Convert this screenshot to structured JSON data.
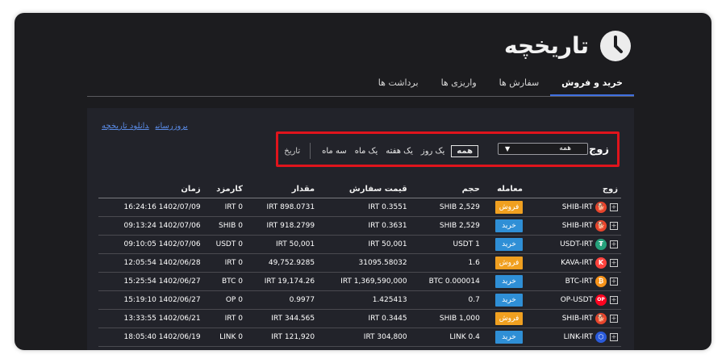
{
  "header": {
    "title": "تاریخچه",
    "tabs": [
      {
        "label": "خرید و فروش",
        "active": true
      },
      {
        "label": "سفارش ها",
        "active": false
      },
      {
        "label": "واریزی ها",
        "active": false
      },
      {
        "label": "برداشت ها",
        "active": false
      }
    ]
  },
  "links": {
    "update": "بروزرسانی",
    "download": "دانلود تاریخچه"
  },
  "filters": {
    "pair_label": "زوج :",
    "pair_select_value": "همه",
    "periods": [
      "همه",
      "یک روز",
      "یک هفته",
      "یک ماه",
      "سه ماه"
    ],
    "active_period": "همه",
    "date_label": "تاریخ"
  },
  "table": {
    "headers": [
      "زوج",
      "معامله",
      "حجم",
      "قیمت سفارش",
      "مقدار",
      "کارمزد",
      "زمان"
    ],
    "rows": [
      {
        "pair": "SHIB-IRT",
        "coin": "shib-icon",
        "trade": "فروش",
        "type": "sell",
        "volume": "SHIB 2,529",
        "price": "IRT 0.3551",
        "amount": "IRT 898.0731",
        "fee": "IRT 0",
        "time": "16:24:16 1402/07/09"
      },
      {
        "pair": "SHIB-IRT",
        "coin": "shib-icon",
        "trade": "خرید",
        "type": "buy",
        "volume": "SHIB 2,529",
        "price": "IRT 0.3631",
        "amount": "IRT 918.2799",
        "fee": "SHIB 0",
        "time": "09:13:24 1402/07/06"
      },
      {
        "pair": "USDT-IRT",
        "coin": "usdt-icon",
        "trade": "خرید",
        "type": "buy",
        "volume": "USDT 1",
        "price": "IRT 50,001",
        "amount": "IRT 50,001",
        "fee": "USDT 0",
        "time": "09:10:05 1402/07/06"
      },
      {
        "pair": "KAVA-IRT",
        "coin": "kava-icon",
        "trade": "فروش",
        "type": "sell",
        "volume": "1.6",
        "price": "31095.58032",
        "amount": "49,752.9285",
        "fee": "IRT 0",
        "time": "12:05:54 1402/06/28"
      },
      {
        "pair": "BTC-IRT",
        "coin": "btc-icon",
        "trade": "خرید",
        "type": "buy",
        "volume": "BTC 0.000014",
        "price": "IRT 1,369,590,000",
        "amount": "IRT 19,174.26",
        "fee": "BTC 0",
        "time": "15:25:54 1402/06/27"
      },
      {
        "pair": "OP-USDT",
        "coin": "op-icon",
        "trade": "خرید",
        "type": "buy",
        "volume": "0.7",
        "price": "1.425413",
        "amount": "0.9977",
        "fee": "OP 0",
        "time": "15:19:10 1402/06/27"
      },
      {
        "pair": "SHIB-IRT",
        "coin": "shib-icon",
        "trade": "فروش",
        "type": "sell",
        "volume": "SHIB 1,000",
        "price": "IRT 0.3445",
        "amount": "IRT 344.565",
        "fee": "IRT 0",
        "time": "13:33:55 1402/06/21"
      },
      {
        "pair": "LINK-IRT",
        "coin": "link-icon",
        "trade": "خرید",
        "type": "buy",
        "volume": "LINK 0.4",
        "price": "IRT 304,800",
        "amount": "IRT 121,920",
        "fee": "LINK 0",
        "time": "18:05:40 1402/06/19"
      }
    ]
  },
  "colors": {
    "sell": "#f0a020",
    "buy": "#2f8fd6",
    "accent": "#3f6fe0",
    "highlight": "#e0141c",
    "shib": "#e8452c",
    "usdt": "#26a17b",
    "kava": "#ff433e",
    "btc": "#f7931a",
    "op": "#ff0420",
    "link": "#2a5ada"
  }
}
